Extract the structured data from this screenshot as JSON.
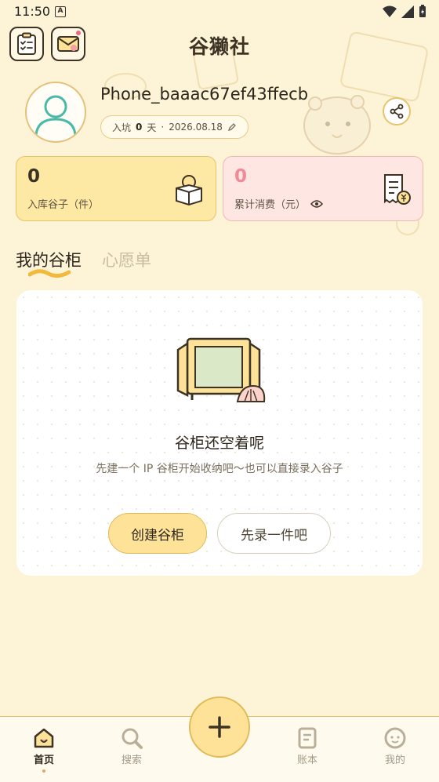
{
  "status_bar": {
    "time": "11:50",
    "notif_icon_letter": "A"
  },
  "header": {
    "title": "谷獭社",
    "left_icons": [
      "clipboard-icon",
      "mail-icon"
    ]
  },
  "profile": {
    "username": "Phone_baaac67ef43ffecb",
    "join_prefix": "入坑",
    "join_days": "0",
    "join_unit": "天",
    "join_sep": "·",
    "join_date": "2026.08.18"
  },
  "stats": {
    "stock": {
      "value": "0",
      "label": "入库谷子（件）"
    },
    "spend": {
      "value": "0",
      "label": "累计消费（元）"
    }
  },
  "tabs": [
    {
      "label": "我的谷柜",
      "active": true
    },
    {
      "label": "心愿单",
      "active": false
    }
  ],
  "empty_state": {
    "title": "谷柜还空着呢",
    "description": "先建一个 IP 谷柜开始收纳吧～也可以直接录入谷子",
    "primary_button": "创建谷柜",
    "secondary_button": "先录一件吧"
  },
  "bottom_nav": [
    {
      "label": "首页",
      "icon": "home-icon",
      "active": true
    },
    {
      "label": "搜索",
      "icon": "search-icon",
      "active": false
    },
    {
      "label": "账本",
      "icon": "ledger-icon",
      "active": false
    },
    {
      "label": "我的",
      "icon": "profile-icon",
      "active": false
    }
  ],
  "colors": {
    "background": "#fdf3d6",
    "accent_yellow": "#fde297",
    "accent_pink": "#f08a98",
    "card_border": "#e2bb58"
  }
}
